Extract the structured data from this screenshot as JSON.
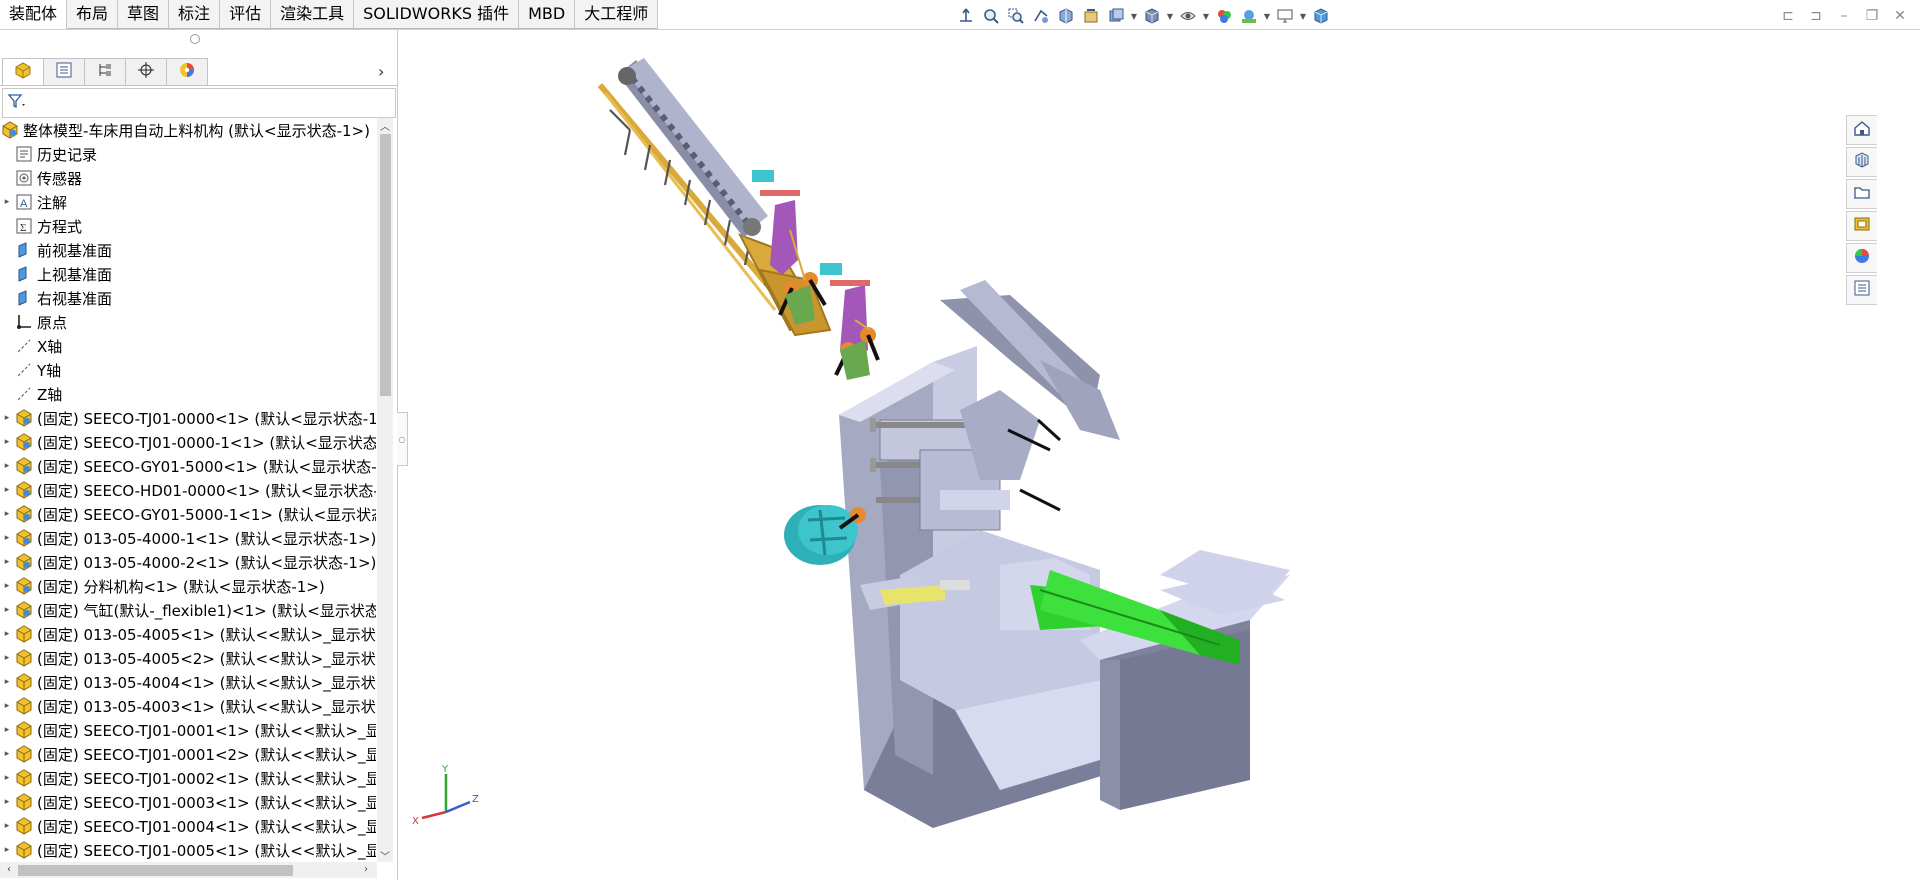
{
  "tabs": [
    {
      "label": "装配体",
      "active": true
    },
    {
      "label": "布局"
    },
    {
      "label": "草图"
    },
    {
      "label": "标注"
    },
    {
      "label": "评估"
    },
    {
      "label": "渲染工具"
    },
    {
      "label": "SOLIDWORKS 插件"
    },
    {
      "label": "MBD"
    },
    {
      "label": "大工程师"
    }
  ],
  "hud_icons": [
    "view-orientation-icon",
    "zoom-to-fit-icon",
    "zoom-to-area-icon",
    "previous-view-icon",
    "section-view-icon",
    "dynamic-annotation-icon",
    "view-orientation-icon",
    "display-style-icon",
    "hide-show-icon",
    "edit-appearance-icon",
    "apply-scene-icon",
    "view-settings-icon",
    "3d-view-icon"
  ],
  "panel": {
    "tabs": [
      "featuremanager-icon",
      "propertymanager-icon",
      "configurationmanager-icon",
      "dimxpert-icon",
      "displaymanager-icon"
    ]
  },
  "tree": {
    "root": "整体模型-车床用自动上料机构  (默认<显示状态-1>)",
    "items": [
      {
        "label": "历史记录",
        "icon": "history-icon",
        "exp": false
      },
      {
        "label": "传感器",
        "icon": "sensor-icon",
        "exp": false
      },
      {
        "label": "注解",
        "icon": "annotation-icon",
        "exp": true
      },
      {
        "label": "方程式",
        "icon": "equation-icon",
        "exp": false
      },
      {
        "label": "前视基准面",
        "icon": "plane-icon",
        "exp": false
      },
      {
        "label": "上视基准面",
        "icon": "plane-icon",
        "exp": false
      },
      {
        "label": "右视基准面",
        "icon": "plane-icon",
        "exp": false
      },
      {
        "label": "原点",
        "icon": "origin-icon",
        "exp": false
      },
      {
        "label": "X轴",
        "icon": "axis-icon",
        "exp": false
      },
      {
        "label": "Y轴",
        "icon": "axis-icon",
        "exp": false
      },
      {
        "label": "Z轴",
        "icon": "axis-icon",
        "exp": false
      },
      {
        "label": "(固定) SEECO-TJ01-0000<1> (默认<显示状态-1",
        "icon": "assembly-icon",
        "exp": true
      },
      {
        "label": "(固定) SEECO-TJ01-0000-1<1> (默认<显示状态",
        "icon": "assembly-icon",
        "exp": true
      },
      {
        "label": "(固定) SEECO-GY01-5000<1> (默认<显示状态-",
        "icon": "assembly-icon",
        "exp": true
      },
      {
        "label": "(固定) SEECO-HD01-0000<1> (默认<显示状态-",
        "icon": "assembly-icon",
        "exp": true
      },
      {
        "label": "(固定) SEECO-GY01-5000-1<1> (默认<显示状态",
        "icon": "assembly-icon",
        "exp": true
      },
      {
        "label": "(固定) 013-05-4000-1<1> (默认<显示状态-1>)",
        "icon": "assembly-icon",
        "exp": true
      },
      {
        "label": "(固定) 013-05-4000-2<1> (默认<显示状态-1>)",
        "icon": "assembly-icon",
        "exp": true
      },
      {
        "label": "(固定) 分料机构<1> (默认<显示状态-1>)",
        "icon": "assembly-icon",
        "exp": true
      },
      {
        "label": "(固定) 气缸(默认-_flexible1)<1> (默认<显示状态",
        "icon": "assembly-icon",
        "exp": true
      },
      {
        "label": "(固定) 013-05-4005<1> (默认<<默认>_显示状",
        "icon": "part-icon",
        "exp": true
      },
      {
        "label": "(固定) 013-05-4005<2> (默认<<默认>_显示状",
        "icon": "part-icon",
        "exp": true
      },
      {
        "label": "(固定) 013-05-4004<1> (默认<<默认>_显示状",
        "icon": "part-icon",
        "exp": true
      },
      {
        "label": "(固定) 013-05-4003<1> (默认<<默认>_显示状",
        "icon": "part-icon",
        "exp": true
      },
      {
        "label": "(固定) SEECO-TJ01-0001<1> (默认<<默认>_显",
        "icon": "part-icon",
        "exp": true
      },
      {
        "label": "(固定) SEECO-TJ01-0001<2> (默认<<默认>_显",
        "icon": "part-icon",
        "exp": true
      },
      {
        "label": "(固定) SEECO-TJ01-0002<1> (默认<<默认>_显",
        "icon": "part-icon",
        "exp": true
      },
      {
        "label": "(固定) SEECO-TJ01-0003<1> (默认<<默认>_显",
        "icon": "part-icon",
        "exp": true
      },
      {
        "label": "(固定) SEECO-TJ01-0004<1> (默认<<默认>_显",
        "icon": "part-icon",
        "exp": true
      },
      {
        "label": "(固定) SEECO-TJ01-0005<1> (默认<<默认>_显",
        "icon": "part-icon",
        "exp": true
      }
    ]
  },
  "taskpane_icons": [
    "solidworks-resources-icon",
    "design-library-icon",
    "file-explorer-icon",
    "view-palette-icon",
    "appearances-icon",
    "custom-properties-icon"
  ],
  "triad": {
    "x": "X",
    "y": "Y",
    "z": "Z"
  },
  "colors": {
    "body": "#a9acc4",
    "body_dark": "#7d809a",
    "body_light": "#d6d8ee",
    "gold": "#d9a93a",
    "purple": "#a357b8",
    "cyan": "#3ec4cc",
    "green": "#2fd12f",
    "orange": "#e68a2e"
  }
}
